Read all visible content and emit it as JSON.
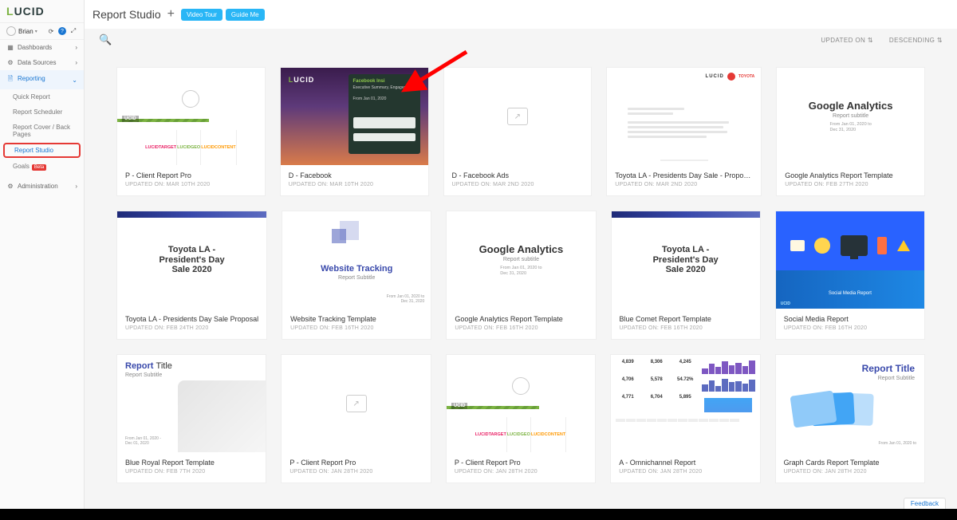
{
  "brand": {
    "name": "LUCID"
  },
  "user": {
    "name": "Brian"
  },
  "header": {
    "title": "Report Studio",
    "video_tour": "Video Tour",
    "guide_me": "Guide Me"
  },
  "sort": {
    "updated": "UPDATED ON",
    "order": "DESCENDING"
  },
  "nav": {
    "dashboards": "Dashboards",
    "data_sources": "Data Sources",
    "reporting": "Reporting",
    "quick_report": "Quick Report",
    "report_scheduler": "Report Scheduler",
    "report_cover": "Report Cover / Back Pages",
    "report_studio": "Report Studio",
    "goals": "Goals",
    "goals_badge": "Beta",
    "administration": "Administration"
  },
  "feedback": "Feedback",
  "tiles": [
    {
      "title": "P - Client Report Pro",
      "sub": "UPDATED ON: MAR 10TH 2020"
    },
    {
      "title": "D - Facebook",
      "sub": "UPDATED ON: MAR 10TH 2020"
    },
    {
      "title": "D - Facebook Ads",
      "sub": "UPDATED ON: MAR 2ND 2020"
    },
    {
      "title": "Toyota LA - Presidents Day Sale - Propos...",
      "sub": "UPDATED ON: MAR 2ND 2020"
    },
    {
      "title": "Google Analytics Report Template",
      "sub": "UPDATED ON: FEB 27TH 2020"
    },
    {
      "title": "Toyota LA - Presidents Day Sale Proposal",
      "sub": "UPDATED ON: FEB 24TH 2020"
    },
    {
      "title": "Website Tracking Template",
      "sub": "UPDATED ON: FEB 16TH 2020"
    },
    {
      "title": "Google Analytics Report Template",
      "sub": "UPDATED ON: FEB 16TH 2020"
    },
    {
      "title": "Blue Comet Report Template",
      "sub": "UPDATED ON: FEB 16TH 2020"
    },
    {
      "title": "Social Media Report",
      "sub": "UPDATED ON: FEB 16TH 2020"
    },
    {
      "title": "Blue Royal Report Template",
      "sub": "UPDATED ON: FEB 7TH 2020"
    },
    {
      "title": "P - Client Report Pro",
      "sub": "UPDATED ON: JAN 28TH 2020"
    },
    {
      "title": "P - Client Report Pro",
      "sub": "UPDATED ON: JAN 28TH 2020"
    },
    {
      "title": "A - Omnichannel Report",
      "sub": "UPDATED ON: JAN 28TH 2020"
    },
    {
      "title": "Graph Cards Report Template",
      "sub": "UPDATED ON: JAN 28TH 2020"
    }
  ],
  "thumbs": {
    "clientpro": {
      "brand": "UCID",
      "t1": "LUCIDTARGET",
      "t2": "LUCIDGEO",
      "t3": "LUCIDCONTENT"
    },
    "fb": {
      "logo": "UCID",
      "panel_title": "Facebook Insi",
      "panel_sub": "Executive Summary, Engageme",
      "panel_from": "From Jan 01, 2020"
    },
    "toyota": {
      "brand": "LUCID",
      "mfg": "TOYOTA"
    },
    "ga": {
      "title": "Google Analytics",
      "sub": "Report subtitle",
      "from": "From Jan 01, 2020 to",
      "to": "Dec 31, 2020"
    },
    "pres": {
      "l1": "Toyota LA -",
      "l2": "President's Day",
      "l3": "Sale 2020"
    },
    "website": {
      "title": "Website Tracking",
      "sub": "Report Subtitle",
      "from": "From Jan 01, 2020 to",
      "to": "Dec 31, 2020"
    },
    "social": {
      "label": "Social Media Report",
      "brand": "UCID"
    },
    "blue": {
      "t1": "Report",
      "t2": "Title",
      "sub": "Report Subtitle",
      "from": "From Jan 01, 2020 -",
      "to": "Dec 01, 2020"
    },
    "omni": {
      "n1": "4,839",
      "n2": "8,306",
      "n3": "4,245",
      "n4": "4,706",
      "n5": "5,578",
      "n6": "54.72%",
      "n7": "4,771",
      "n8": "6,704",
      "n9": "5,895"
    },
    "graph": {
      "title": "Report Title",
      "sub": "Report Subtitle",
      "from": "From Jan 01, 2020 to"
    }
  }
}
